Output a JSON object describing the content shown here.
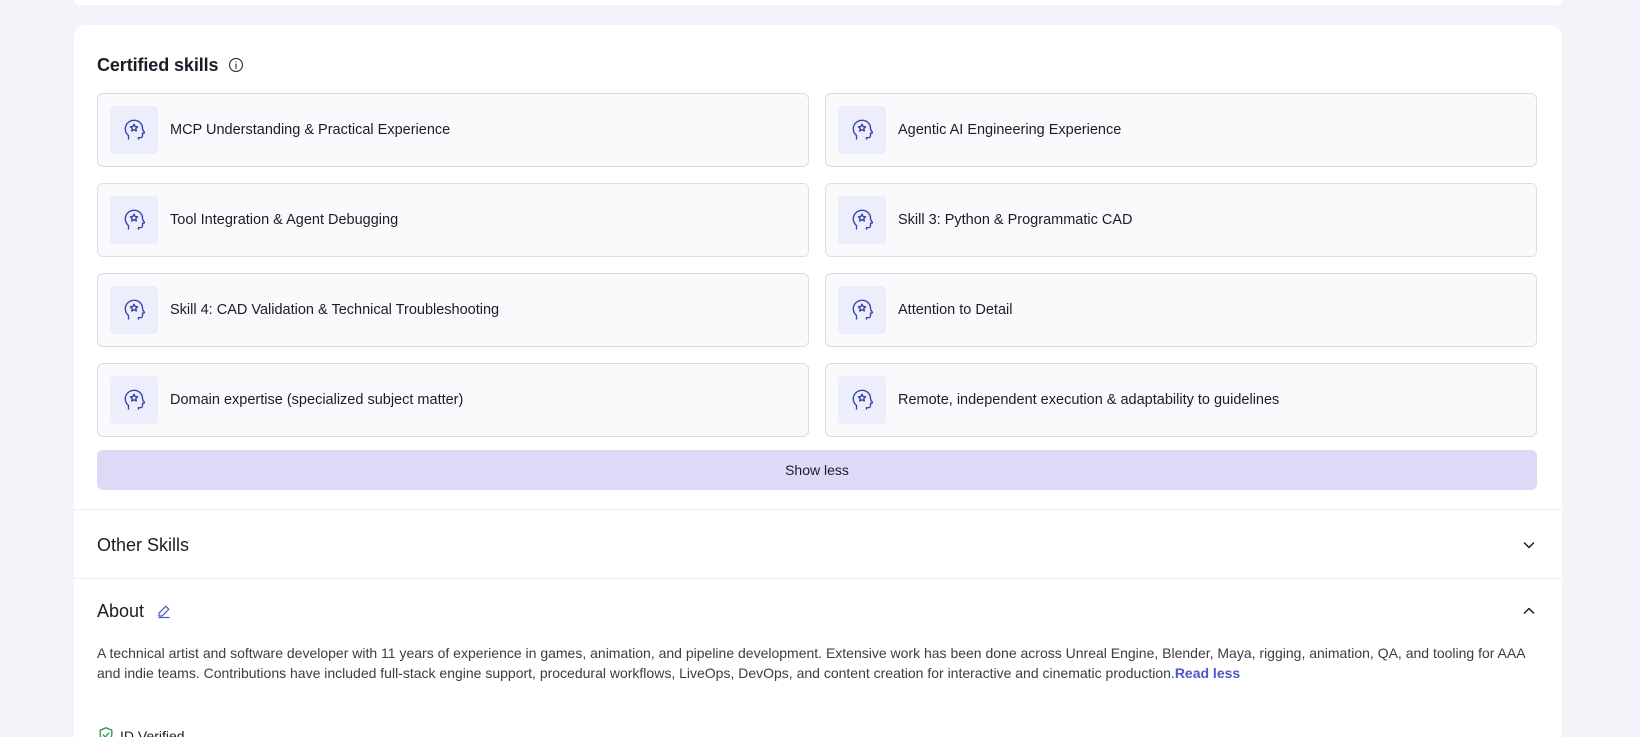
{
  "certified": {
    "title": "Certified skills",
    "skills": [
      {
        "label": "MCP Understanding & Practical Experience"
      },
      {
        "label": "Agentic AI Engineering Experience"
      },
      {
        "label": "Tool Integration & Agent Debugging"
      },
      {
        "label": "Skill 3: Python & Programmatic CAD"
      },
      {
        "label": "Skill 4: CAD Validation & Technical Troubleshooting"
      },
      {
        "label": "Attention to Detail"
      },
      {
        "label": "Domain expertise (specialized subject matter)"
      },
      {
        "label": "Remote, independent execution & adaptability to guidelines"
      }
    ],
    "show_less_label": "Show less"
  },
  "other_skills": {
    "title": "Other Skills"
  },
  "about": {
    "title": "About",
    "text": "A technical artist and software developer with 11 years of experience in games, animation, and pipeline development. Extensive work has been done across Unreal Engine, Blender, Maya, rigging, animation, QA, and tooling for AAA and indie teams. Contributions have included full-stack engine support, procedural workflows, LiveOps, DevOps, and content creation for interactive and cinematic production.",
    "read_less_label": "Read less",
    "verified_label": "ID Verified"
  },
  "colors": {
    "accent": "#4b56c8",
    "show_less_bg": "#dcdaf6",
    "verified_green": "#2e9e5b"
  },
  "icons": {
    "skill": "head-badge-icon",
    "info": "info-icon",
    "edit": "pencil-icon",
    "expand": "chevron-down-icon",
    "collapse": "chevron-up-icon",
    "verified": "shield-check-icon"
  }
}
